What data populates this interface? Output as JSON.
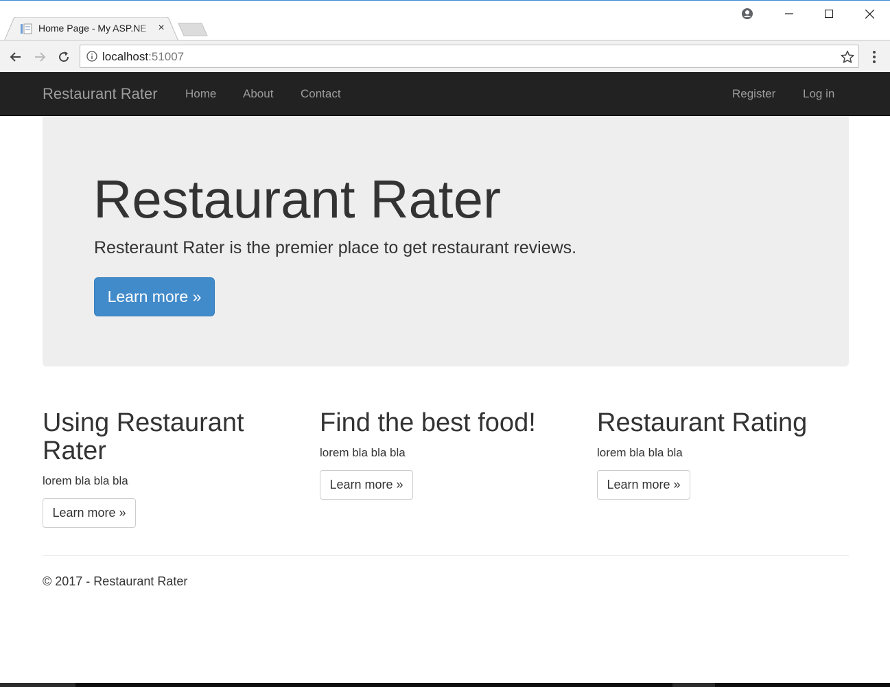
{
  "browser": {
    "tab": {
      "title": "Home Page - My ASP.NE",
      "close_glyph": "×",
      "favicon": "page-icon"
    },
    "window_controls": {
      "profile": "account-icon",
      "minimize": "─",
      "maximize": "☐",
      "close": "✕"
    },
    "address": {
      "host": "localhost",
      "port": ":51007"
    }
  },
  "navbar": {
    "brand": "Restaurant Rater",
    "links": [
      "Home",
      "About",
      "Contact"
    ],
    "right_links": [
      "Register",
      "Log in"
    ]
  },
  "jumbotron": {
    "title": "Restaurant Rater",
    "lead": "Resteraunt Rater is the premier place to get restaurant reviews.",
    "button": "Learn more »"
  },
  "columns": [
    {
      "heading": "Using Restaurant Rater",
      "text": "lorem bla bla bla",
      "button": "Learn more »"
    },
    {
      "heading": "Find the best food!",
      "text": "lorem bla bla bla",
      "button": "Learn more »"
    },
    {
      "heading": "Restaurant Rating",
      "text": "lorem bla bla bla",
      "button": "Learn more »"
    }
  ],
  "footer": {
    "text": "© 2017 - Restaurant Rater"
  },
  "colors": {
    "navbar": "#222222",
    "jumbotron": "#eeeeee",
    "primary": "#428bca",
    "accent_line": "#3b8ad8"
  }
}
